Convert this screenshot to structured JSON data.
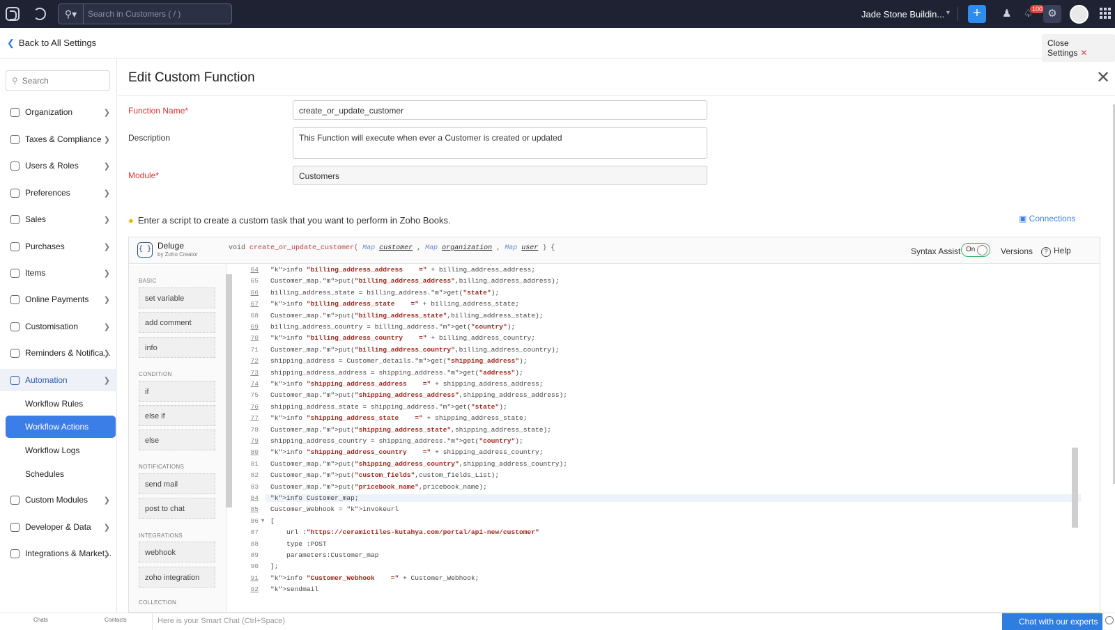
{
  "topbar": {
    "search_placeholder": "Search in Customers ( / )",
    "org_name": "Jade Stone Buildin...",
    "notifications_count": "100"
  },
  "subbar": {
    "back_label": "Back to All Settings",
    "close_label": "Close Settings"
  },
  "sidebar": {
    "search_placeholder": "Search",
    "items": [
      {
        "label": "Organization"
      },
      {
        "label": "Taxes & Compliance"
      },
      {
        "label": "Users & Roles"
      },
      {
        "label": "Preferences"
      },
      {
        "label": "Sales"
      },
      {
        "label": "Purchases"
      },
      {
        "label": "Items"
      },
      {
        "label": "Online Payments"
      },
      {
        "label": "Customisation"
      },
      {
        "label": "Reminders & Notifica..."
      },
      {
        "label": "Automation"
      },
      {
        "label": "Custom Modules"
      },
      {
        "label": "Developer & Data"
      },
      {
        "label": "Integrations & Market..."
      }
    ],
    "automation_sub": [
      {
        "label": "Workflow Rules"
      },
      {
        "label": "Workflow Actions"
      },
      {
        "label": "Workflow Logs"
      },
      {
        "label": "Schedules"
      }
    ]
  },
  "main": {
    "title": "Edit Custom Function",
    "function_name_label": "Function Name*",
    "function_name_value": "create_or_update_customer",
    "description_label": "Description",
    "description_value": "This Function will execute when ever a Customer is created or updated",
    "module_label": "Module*",
    "module_value": "Customers",
    "tip": "Enter a script to create a custom task that you want to perform in Zoho Books.",
    "connections": "Connections"
  },
  "editor": {
    "lang": "Deluge",
    "by": "by Zoho Creator",
    "sig_void": "void",
    "sig_fn": "create_or_update_customer(",
    "sig_t1": "Map",
    "sig_p1": "customer",
    "sig_t2": "Map",
    "sig_p2": "organization",
    "sig_t3": "Map",
    "sig_p3": "user",
    "sig_end": ") {",
    "syntax_assist": "Syntax Assist",
    "toggle": "On",
    "versions": "Versions",
    "help": "Help",
    "palette": {
      "basic": "BASIC",
      "set_variable": "set variable",
      "add_comment": "add comment",
      "info": "info",
      "condition": "CONDITION",
      "if": "if",
      "else_if": "else if",
      "else": "else",
      "notifications": "NOTIFICATIONS",
      "send_mail": "send mail",
      "post_to_chat": "post to chat",
      "integrations": "INTEGRATIONS",
      "webhook": "webhook",
      "zoho_integration": "zoho integration",
      "collection": "COLLECTION"
    },
    "lines": [
      {
        "n": "64",
        "u": true,
        "t": "info \"billing_address_address    =\" + billing_address_address;"
      },
      {
        "n": "65",
        "u": false,
        "t": "Customer_map.put(\"billing_address_address\",billing_address_address);"
      },
      {
        "n": "66",
        "u": true,
        "t": "billing_address_state = billing_address.get(\"state\");"
      },
      {
        "n": "67",
        "u": true,
        "t": "info \"billing_address_state    =\" + billing_address_state;"
      },
      {
        "n": "68",
        "u": false,
        "t": "Customer_map.put(\"billing_address_state\",billing_address_state);"
      },
      {
        "n": "69",
        "u": true,
        "t": "billing_address_country = billing_address.get(\"country\");"
      },
      {
        "n": "70",
        "u": true,
        "t": "info \"billing_address_country    =\" + billing_address_country;"
      },
      {
        "n": "71",
        "u": false,
        "t": "Customer_map.put(\"billing_address_country\",billing_address_country);"
      },
      {
        "n": "72",
        "u": true,
        "t": "shipping_address = Customer_details.get(\"shipping_address\");"
      },
      {
        "n": "73",
        "u": true,
        "t": "shipping_address_address = shipping_address.get(\"address\");"
      },
      {
        "n": "74",
        "u": true,
        "t": "info \"shipping_address_address    =\" + shipping_address_address;"
      },
      {
        "n": "75",
        "u": false,
        "t": "Customer_map.put(\"shipping_address_address\",shipping_address_address);"
      },
      {
        "n": "76",
        "u": true,
        "t": "shipping_address_state = shipping_address.get(\"state\");"
      },
      {
        "n": "77",
        "u": true,
        "t": "info \"shipping_address_state    =\" + shipping_address_state;"
      },
      {
        "n": "78",
        "u": false,
        "t": "Customer_map.put(\"shipping_address_state\",shipping_address_state);"
      },
      {
        "n": "79",
        "u": true,
        "t": "shipping_address_country = shipping_address.get(\"country\");"
      },
      {
        "n": "80",
        "u": true,
        "t": "info \"shipping_address_country    =\" + shipping_address_country;"
      },
      {
        "n": "81",
        "u": false,
        "t": "Customer_map.put(\"shipping_address_country\",shipping_address_country);"
      },
      {
        "n": "82",
        "u": false,
        "t": "Customer_map.put(\"custom_fields\",custom_fields_List);"
      },
      {
        "n": "83",
        "u": false,
        "t": "Customer_map.put(\"pricebook_name\",pricebook_name);"
      },
      {
        "n": "84",
        "u": true,
        "t": "info Customer_map;"
      },
      {
        "n": "85",
        "u": true,
        "t": "Customer_Webhook = invokeurl"
      },
      {
        "n": "86",
        "u": false,
        "t": "["
      },
      {
        "n": "87",
        "u": false,
        "t": "    url :\"https://ceramictiles-kutahya.com/portal/api-new/customer\""
      },
      {
        "n": "88",
        "u": false,
        "t": "    type :POST"
      },
      {
        "n": "89",
        "u": false,
        "t": "    parameters:Customer_map"
      },
      {
        "n": "90",
        "u": false,
        "t": "];"
      },
      {
        "n": "91",
        "u": true,
        "t": "info \"Customer_Webhook    =\" + Customer_Webhook;"
      },
      {
        "n": "92",
        "u": true,
        "t": "sendmail"
      }
    ]
  },
  "bottombar": {
    "chats": "Chats",
    "contacts": "Contacts",
    "smart_chat": "Here is your Smart Chat (Ctrl+Space)",
    "expert": "Chat with our experts"
  }
}
